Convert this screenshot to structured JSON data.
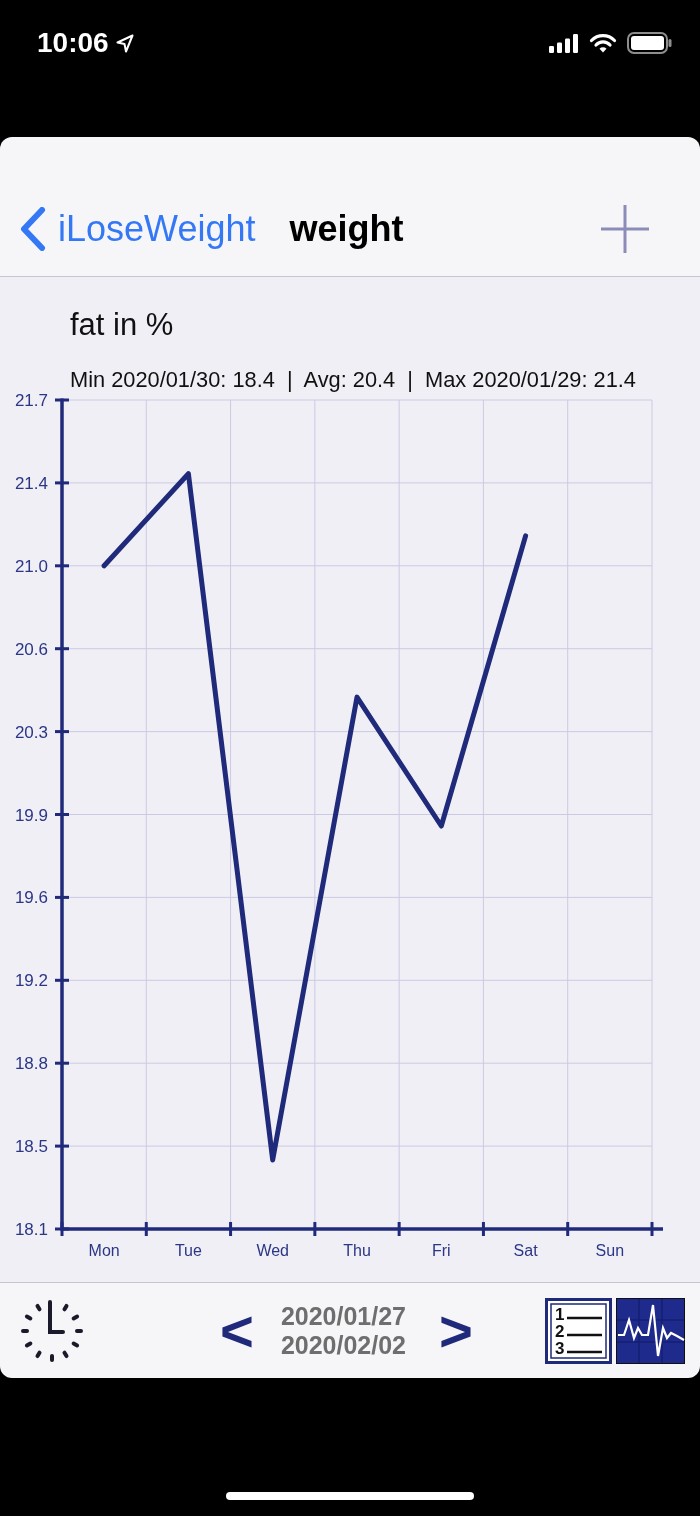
{
  "status_bar": {
    "time": "10:06"
  },
  "nav_bar": {
    "back_label": "iLoseWeight",
    "title": "weight"
  },
  "chart": {
    "summary": "Min 2020/01/30: 18.4  |  Avg: 20.4  |  Max 2020/01/29: 21.4",
    "chart_data": {
      "type": "line",
      "title": "fat in %",
      "grid": true,
      "categories": [
        "Mon",
        "Tue",
        "Wed",
        "Thu",
        "Fri",
        "Sat",
        "Sun"
      ],
      "values": [
        21.0,
        21.4,
        18.42,
        20.43,
        19.87,
        21.13,
        null
      ],
      "ylim": [
        18.12,
        21.72
      ],
      "yticks": [
        {
          "value": 21.72,
          "label": "21.7"
        },
        {
          "value": 21.36,
          "label": "21.4"
        },
        {
          "value": 21.0,
          "label": "21.0"
        },
        {
          "value": 20.64,
          "label": "20.6"
        },
        {
          "value": 20.28,
          "label": "20.3"
        },
        {
          "value": 19.92,
          "label": "19.9"
        },
        {
          "value": 19.56,
          "label": "19.6"
        },
        {
          "value": 19.2,
          "label": "19.2"
        },
        {
          "value": 18.84,
          "label": "18.8"
        },
        {
          "value": 18.48,
          "label": "18.5"
        },
        {
          "value": 18.12,
          "label": "18.1"
        }
      ]
    }
  },
  "toolbar": {
    "previous": "<",
    "date_range": [
      "2020/01/27",
      "2020/02/02"
    ],
    "next": ">",
    "list_numbers": [
      "1",
      "2",
      "3"
    ]
  }
}
